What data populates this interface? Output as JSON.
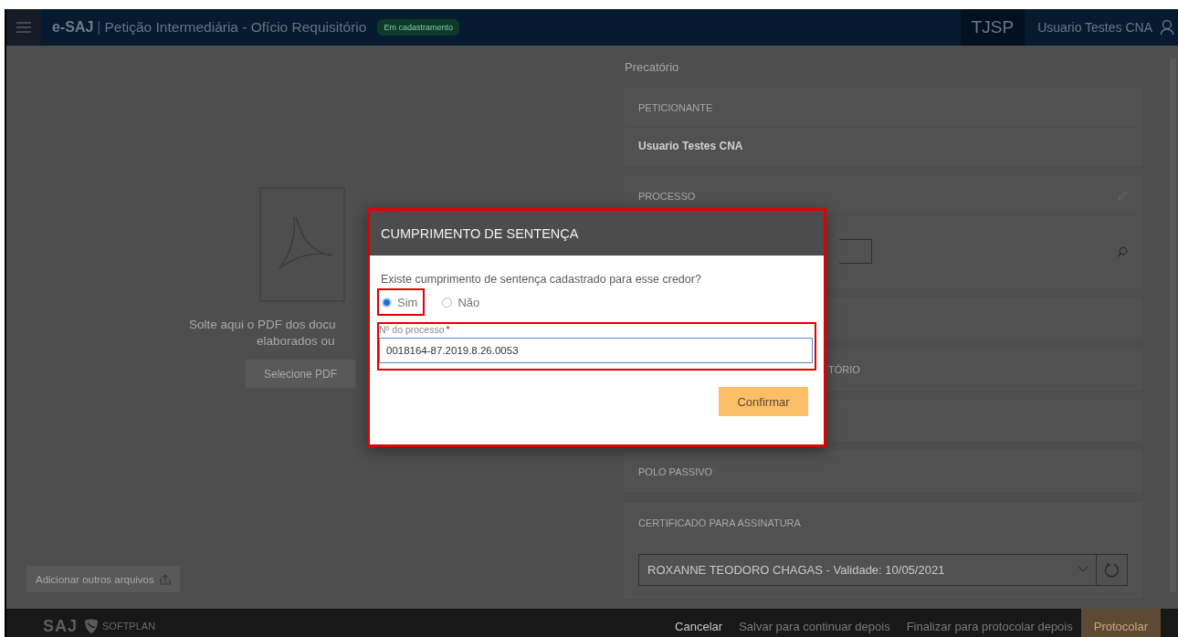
{
  "header": {
    "brand": "e-SAJ",
    "separator": "|",
    "title": "Petição Intermediária - Ofício Requisitório",
    "status_badge": "Em cadastramento",
    "court": "TJSP",
    "user": "Usuario Testes CNA"
  },
  "upload": {
    "drop_text_lines": [
      "Solte aqui o PDF dos docu",
      "elaborados ou"
    ],
    "select_button": "Selecione PDF",
    "add_files_button": "Adicionar outros arquivos"
  },
  "form": {
    "heading": "Precatório",
    "sections": [
      {
        "kind": "value",
        "label": "PETICIONANTE",
        "value": "Usuario Testes CNA"
      },
      {
        "kind": "process",
        "label": "PROCESSO"
      },
      {
        "kind": "plain"
      },
      {
        "kind": "plain",
        "label": "TÓRIO"
      },
      {
        "kind": "plain"
      },
      {
        "kind": "plain",
        "label": "POLO PASSIVO"
      },
      {
        "kind": "select",
        "label": "CERTIFICADO PARA ASSINATURA",
        "value": "ROXANNE TEODORO CHAGAS - Validade: 10/05/2021"
      }
    ]
  },
  "dialog": {
    "title": "CUMPRIMENTO DE SENTENÇA",
    "highlighted": true,
    "question": "Existe cumprimento de sentença cadastrado para esse credor?",
    "options": [
      {
        "label": "Sim",
        "selected": true,
        "highlighted": true
      },
      {
        "label": "Não",
        "selected": false,
        "highlighted": false
      }
    ],
    "field": {
      "label": "Nº do processo",
      "required_mark": "*",
      "value": "0018164-87.2019.8.26.0053",
      "highlighted": true
    },
    "confirm_button": "Confirmar"
  },
  "footer": {
    "logos": [
      "SAJ",
      "SOFTPLAN"
    ],
    "actions": [
      {
        "kind": "link",
        "label": "Cancelar",
        "disabled": false
      },
      {
        "kind": "link",
        "label": "Salvar para continuar depois",
        "disabled": true
      },
      {
        "kind": "link",
        "label": "Finalizar para protocolar depois",
        "disabled": true
      },
      {
        "kind": "primary",
        "label": "Protocolar",
        "disabled": true
      }
    ]
  }
}
